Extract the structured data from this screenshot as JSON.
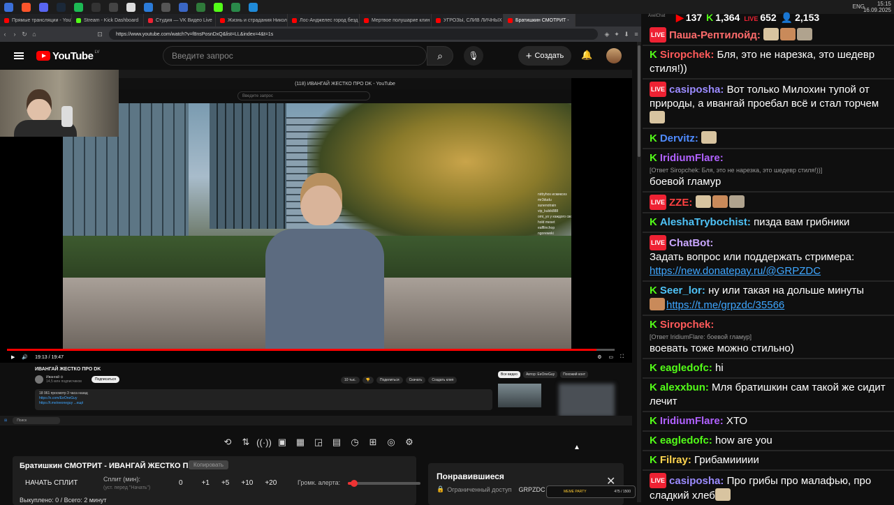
{
  "taskbar": {
    "clock_time": "15:15",
    "clock_date": "16.09.2025",
    "lang": "ENG"
  },
  "browser": {
    "tabs": [
      {
        "title": "Прямые трансляции - YouTu",
        "color": "#ff0000"
      },
      {
        "title": "Stream - Kick Dashboard",
        "color": "#53fc18"
      },
      {
        "title": "Студия — VK Видео Live",
        "color": "#e23"
      },
      {
        "title": "Жизнь и страдания Никола",
        "color": "#ff0000"
      },
      {
        "title": "Лос-Анджелес город безд",
        "color": "#ff0000"
      },
      {
        "title": "Мертвое полушарие клин",
        "color": "#ff0000"
      },
      {
        "title": "УГРОЗЫ, СЛИВ ЛИЧНЫХ Д",
        "color": "#ff0000"
      },
      {
        "title": "Братишкин СМОТРИТ -",
        "color": "#ff0000"
      }
    ],
    "url": "https://www.youtube.com/watch?v=f8nsPosnDxQ&list=LL&index=4&t=1s"
  },
  "youtube": {
    "region": "LV",
    "logo_text": "YouTube",
    "search_placeholder": "Введите запрос",
    "create_label": "Создать",
    "inner": {
      "window_title": "(118) ИВАНГАЙ ЖЕСТКО ПРО DK - YouTube",
      "search_placeholder": "Введите запрос",
      "time": "19:13 / 19:47",
      "progress": 0.97,
      "video_title": "ИВАНГАЙ ЖЕСТКО ПРО DK",
      "channel": "Ивангай ⊙",
      "subs": "14,5 млн подписчиков",
      "subscribe": "Подписаться",
      "actions": [
        "10 тыс.",
        "",
        "Поделиться",
        "Скачать",
        "Создать клип"
      ],
      "desc_line1": "18 961 просмотр  3 часа назад",
      "desc_line2": "https://x.com/EeOneGuy",
      "desc_line3": "https://t.me/eeoneguy  ...ещё",
      "rec_tabs": [
        "Все видео",
        "Автор: EeOneGuy",
        "Похожий конт"
      ],
      "taskbar_search": "Поиск",
      "chat_lines": [
        "nirbyhos исмиксез",
        "mr3dudu",
        "sunenotrain",
        "vip_kubik888",
        "omi_yo у каждого свой контент, че",
        "hold meset",
        "eafflinchop",
        "ngoreweki"
      ]
    }
  },
  "tools": [
    "⟲",
    "⇅",
    "((·))",
    "▣",
    "▦",
    "◲",
    "▤",
    "◷",
    "⊞",
    "◎",
    "⚙"
  ],
  "split_panel": {
    "title": "Братишкин СМОТРИТ - ИВАНГАЙ ЖЕСТКО ПРО DK",
    "copy_label": "Копировать",
    "start_split": "НАЧАТЬ СПЛИТ",
    "split_min_label": "Сплит (мин):",
    "split_min_hint": "(уст. перед \"Начать\")",
    "value": "0",
    "steps": [
      "+1",
      "+5",
      "+10",
      "+20"
    ],
    "alert_volume_label": "Громк. алерта:",
    "alert_volume": 0.09,
    "count_line": "Выкуплено: 0 / Всего: 2 минут"
  },
  "liked_panel": {
    "title": "Понравившиеся",
    "access": "Ограниченный доступ",
    "owner": "GRPZDC · 3"
  },
  "widget": {
    "label": "MEME PARTY",
    "count": "475 / 1500"
  },
  "chat_header": {
    "app_name": "AxelChat",
    "youtube_viewers": "137",
    "kick_viewers": "1,364",
    "vk_viewers": "652",
    "total_viewers": "2,153"
  },
  "chat": [
    {
      "platform": "live",
      "nick": "Паша-Рептилойд:",
      "color": "#ff6b6b",
      "text": "",
      "emotes": 3
    },
    {
      "platform": "kick",
      "nick": "Siropchek:",
      "color": "#ff5a5a",
      "text": "Бля, это не нарезка, это шедевр стиля!))"
    },
    {
      "platform": "live",
      "nick": "casiposha:",
      "color": "#9b8bff",
      "text": "Вот только Милохин тупой от природы, а ивангай проебал всё и стал торчем",
      "emotes": 1
    },
    {
      "platform": "kick",
      "nick": "Dervitz:",
      "color": "#4f8bff",
      "text": "",
      "emotes": 1
    },
    {
      "platform": "kick",
      "nick": "IridiumFlare:",
      "color": "#b061ff",
      "reply": "[Ответ Siropchek: Бля, это не нарезка, это шедевр стиля!))]",
      "text": "боевой гламур"
    },
    {
      "platform": "live",
      "nick": "ZZE:",
      "color": "#ff4040",
      "text": "",
      "emotes": 3
    },
    {
      "platform": "kick",
      "nick": "AleshaTrybochist:",
      "color": "#4fc3f7",
      "text": "пизда вам грибники"
    },
    {
      "platform": "live",
      "nick": "ChatBot:",
      "color": "#c9a7ff",
      "text": "Задать вопрос или поддержать стримера:",
      "link": "https://new.donatepay.ru/@GRPZDC"
    },
    {
      "platform": "kick",
      "nick": "Seer_lor:",
      "color": "#4fc3f7",
      "text": "ну или такая на дольше минуты",
      "link": "https://t.me/grpzdc/35566",
      "emotes": 1
    },
    {
      "platform": "kick",
      "nick": "Siropchek:",
      "color": "#ff5a5a",
      "reply": "[Ответ IridiumFlare: боевой гламур]",
      "text": "воевать тоже можно стильно)"
    },
    {
      "platform": "kick",
      "nick": "eagledofc:",
      "color": "#53fc18",
      "text": "hi"
    },
    {
      "platform": "kick",
      "nick": "alexxbun:",
      "color": "#53fc18",
      "text": "Мля братишкин сам такой же сидит лечит"
    },
    {
      "platform": "kick",
      "nick": "IridiumFlare:",
      "color": "#b061ff",
      "text": "ХТО"
    },
    {
      "platform": "kick",
      "nick": "eagledofc:",
      "color": "#53fc18",
      "text": "how are you"
    },
    {
      "platform": "kick",
      "nick": "Filray:",
      "color": "#ffd54f",
      "text": "Грибамиииии"
    },
    {
      "platform": "live",
      "nick": "casiposha:",
      "color": "#9b8bff",
      "text": "Про грибы про малафью, про сладкий хлеб",
      "emotes": 1
    }
  ]
}
